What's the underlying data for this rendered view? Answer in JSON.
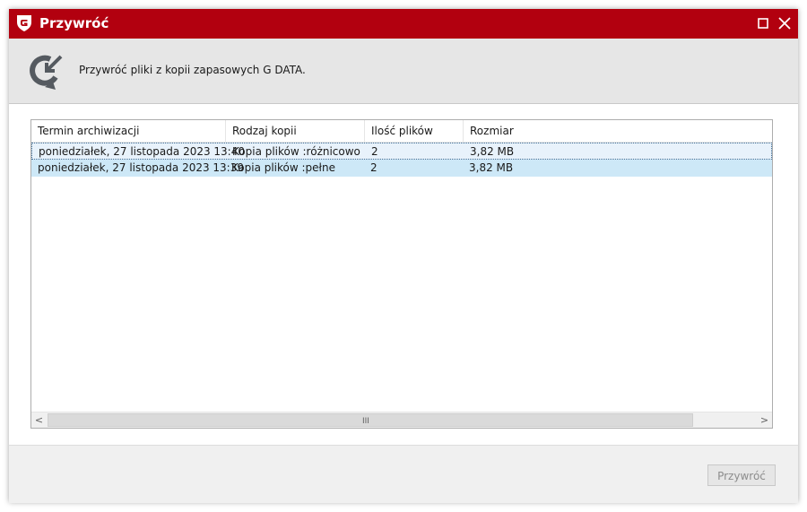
{
  "window": {
    "title": "Przywróć",
    "accent": "#b2000f"
  },
  "header": {
    "description": "Przywróć pliki z kopii zapasowych G DATA."
  },
  "table": {
    "columns": [
      "Termin archiwizacji",
      "Rodzaj kopii",
      "Ilość plików",
      "Rozmiar"
    ],
    "rows": [
      [
        "poniedziałek, 27 listopada 2023 13:40",
        "Kopia plików :różnicowo",
        "2",
        "3,82 MB"
      ],
      [
        "poniedziałek, 27 listopada 2023 13:39",
        "Kopia plików :pełne",
        "2",
        "3,82 MB"
      ]
    ],
    "selected_row": 2
  },
  "scrollbar": {
    "grip": "III",
    "left": "<",
    "right": ">"
  },
  "footer": {
    "restore_button": "Przywróć",
    "restore_button_enabled": false
  },
  "icons": [
    "gdata-shield-icon",
    "restore-arrow-icon",
    "maximize-icon",
    "close-icon"
  ]
}
